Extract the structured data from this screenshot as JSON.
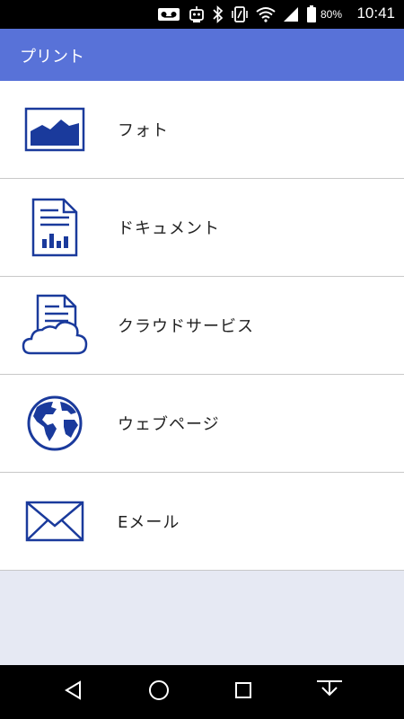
{
  "status_bar": {
    "battery_percent": "80%",
    "time": "10:41",
    "icons": [
      "voicemail-icon",
      "robot-icon",
      "bluetooth-icon",
      "vibrate-icon",
      "wifi-icon",
      "signal-icon",
      "battery-icon"
    ]
  },
  "app_bar": {
    "title": "プリント"
  },
  "menu": {
    "items": [
      {
        "icon": "photo-icon",
        "label": "フォト"
      },
      {
        "icon": "document-icon",
        "label": "ドキュメント"
      },
      {
        "icon": "cloud-service-icon",
        "label": "クラウドサービス"
      },
      {
        "icon": "globe-icon",
        "label": "ウェブページ"
      },
      {
        "icon": "email-icon",
        "label": "Eメール"
      }
    ]
  },
  "nav_bar": {
    "icons": [
      "back-icon",
      "home-icon",
      "recents-icon",
      "hide-keyboard-icon"
    ]
  },
  "colors": {
    "app_bar": "#5872d8",
    "icon_blue": "#1a3a9c",
    "background": "#e6e9f3"
  }
}
